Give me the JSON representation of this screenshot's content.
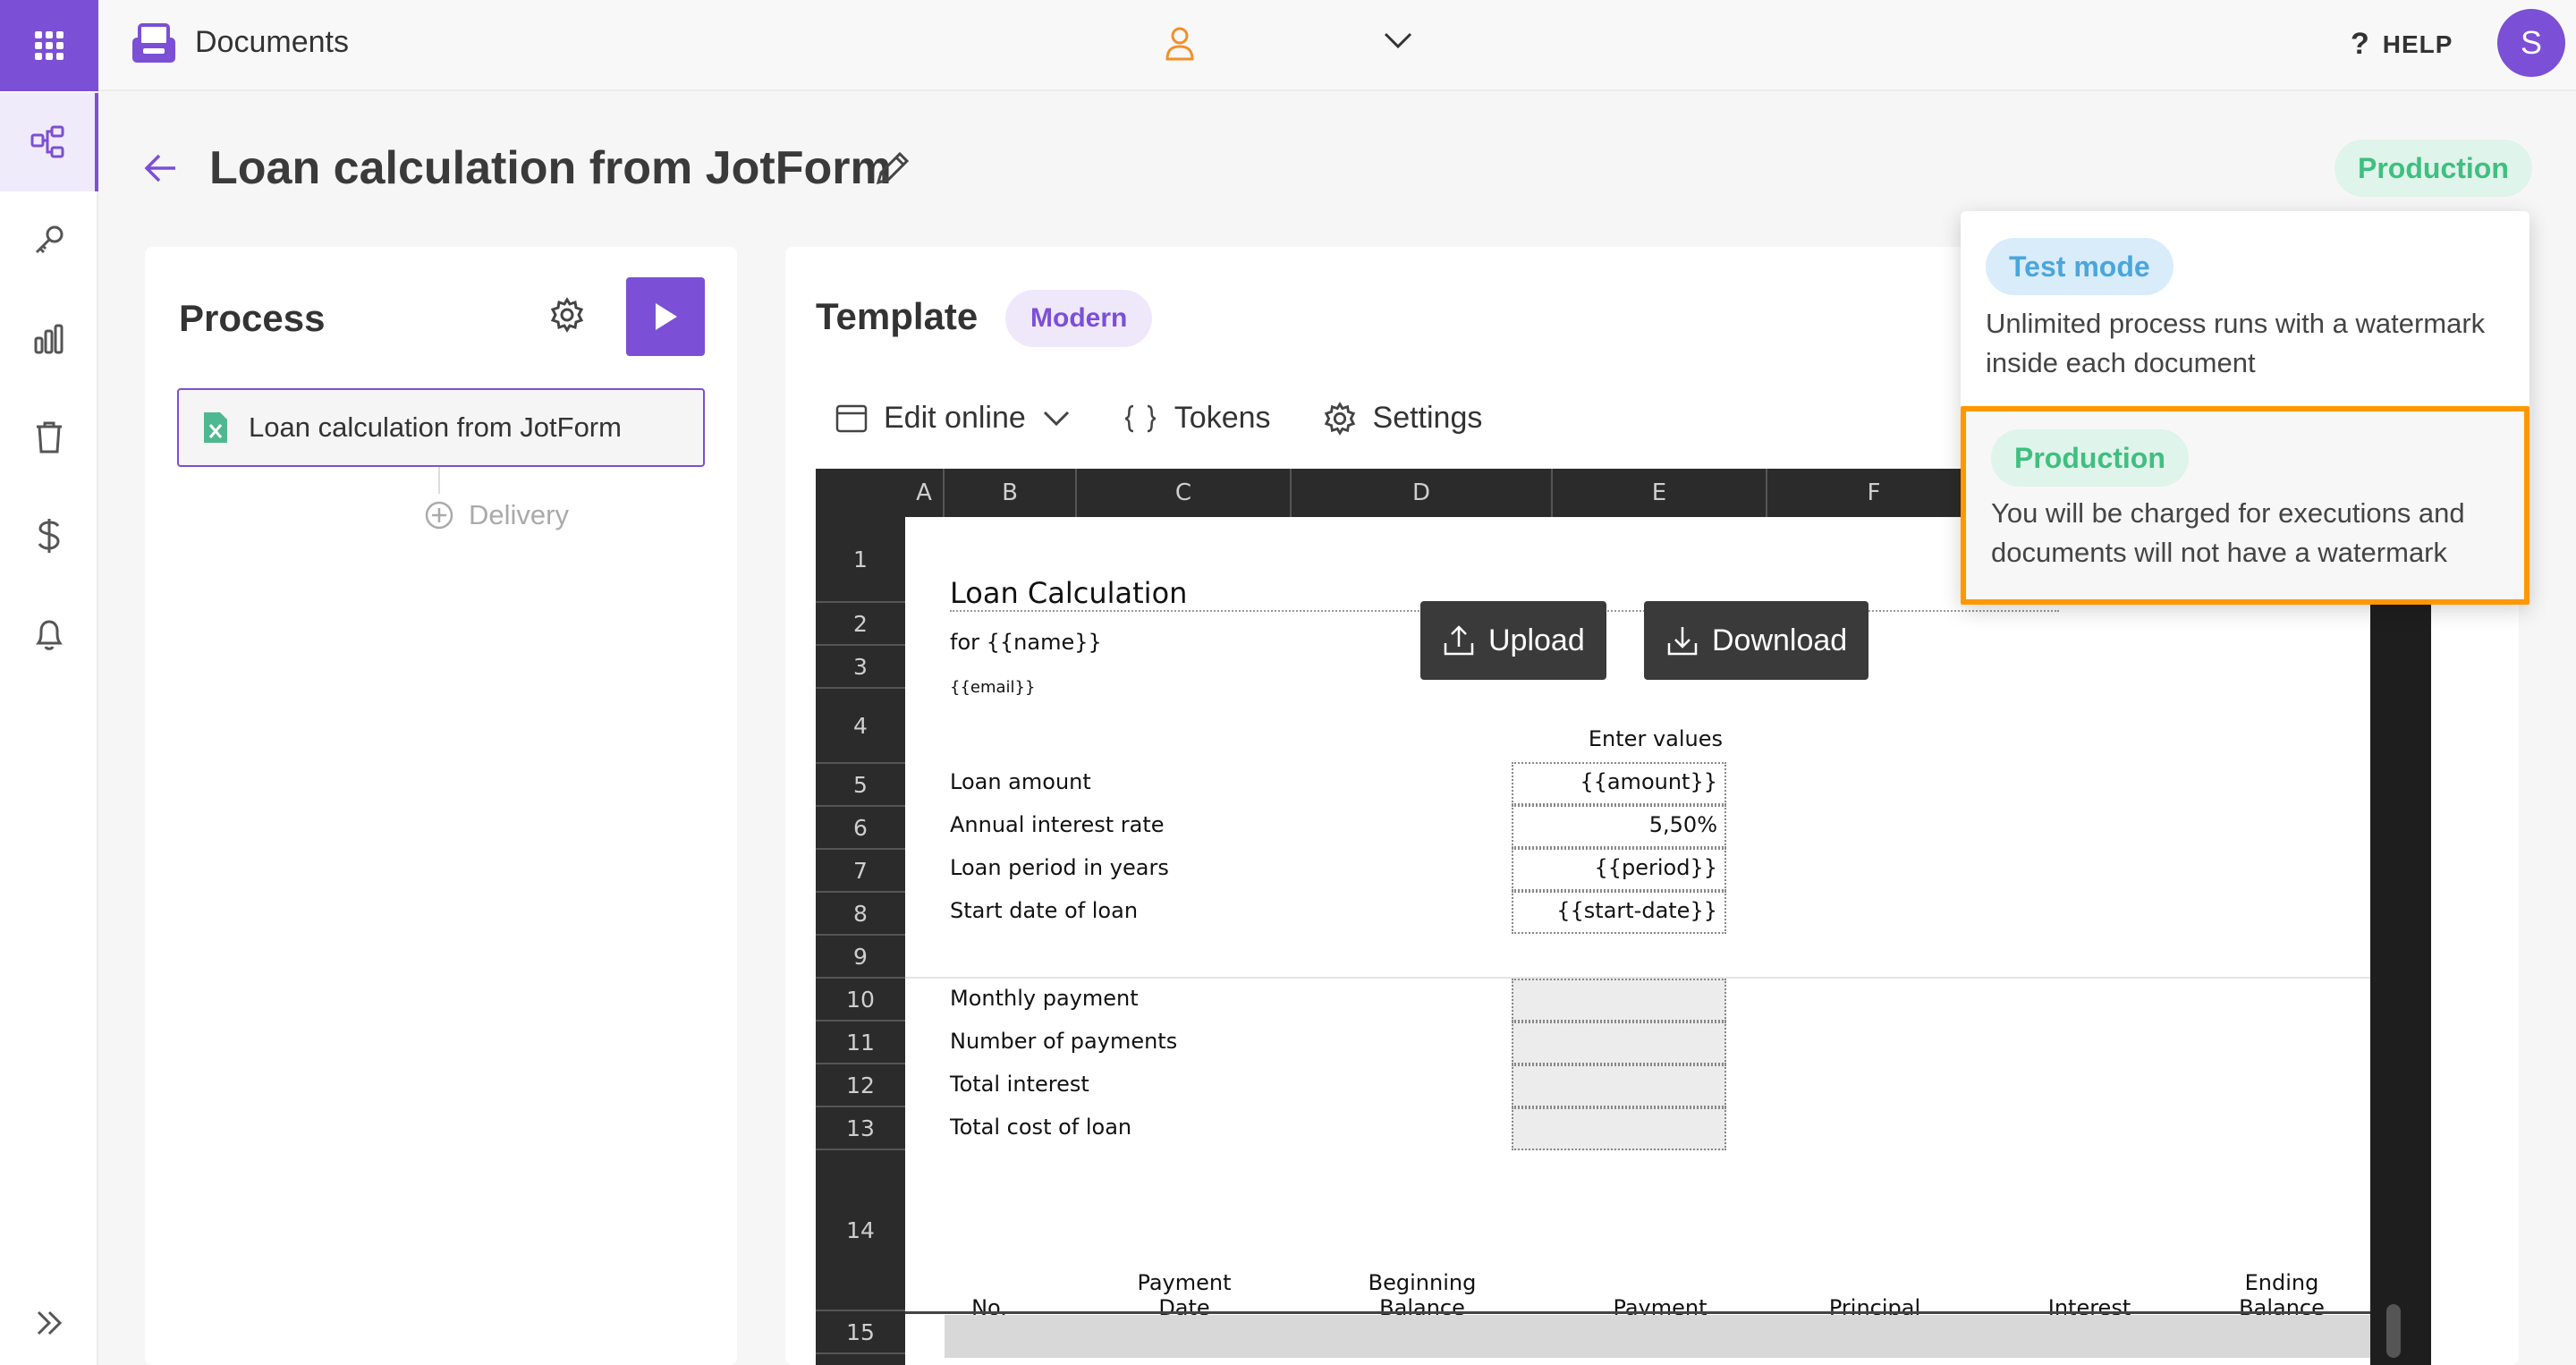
{
  "app": {
    "title": "Documents",
    "user_initial": "S",
    "help_label": "HELP",
    "help_glyph": "?"
  },
  "page": {
    "title": "Loan calculation from JotForm",
    "environment": "Production"
  },
  "process": {
    "title": "Process",
    "item_label": "Loan calculation from JotForm",
    "delivery_label": "Delivery"
  },
  "template": {
    "title": "Template",
    "style": "Modern",
    "toolbar": {
      "edit_online": "Edit online",
      "tokens": "Tokens",
      "settings": "Settings"
    },
    "upload_label": "Upload",
    "download_label": "Download"
  },
  "sheet": {
    "columns": [
      "A",
      "B",
      "C",
      "D",
      "E",
      "F"
    ],
    "rows": [
      "1",
      "2",
      "3",
      "4",
      "5",
      "6",
      "7",
      "8",
      "9",
      "10",
      "11",
      "12",
      "13",
      "14",
      "15"
    ],
    "title": "Loan Calculation",
    "for_name": "for {{name}}",
    "email": "{{email}}",
    "enter_values": "Enter values",
    "labels": {
      "loan_amount": "Loan amount",
      "interest_rate": "Annual interest rate",
      "period": "Loan period in years",
      "start_date": "Start date of loan",
      "monthly_payment": "Monthly payment",
      "num_payments": "Number of payments",
      "total_interest": "Total interest",
      "total_cost": "Total cost of loan"
    },
    "values": {
      "amount": "{{amount}}",
      "rate": "5,50%",
      "period": "{{period}}",
      "start_date": "{{start-date}}"
    },
    "table_headers": {
      "no": "No.",
      "payment_date_1": "Payment",
      "payment_date_2": "Date",
      "beginning_1": "Beginning",
      "beginning_2": "Balance",
      "payment": "Payment",
      "principal": "Principal",
      "interest": "Interest",
      "ending_1": "Ending",
      "ending_2": "Balance"
    }
  },
  "env_dropdown": {
    "test": {
      "label": "Test mode",
      "desc": "Unlimited process runs with a watermark inside each document"
    },
    "production": {
      "label": "Production",
      "desc": "You will be charged for executions and documents will not have a watermark"
    }
  },
  "colors": {
    "accent": "#7b4fd6",
    "production": "#3fbf80",
    "test": "#4aa6dc",
    "highlight": "#ff9800"
  }
}
